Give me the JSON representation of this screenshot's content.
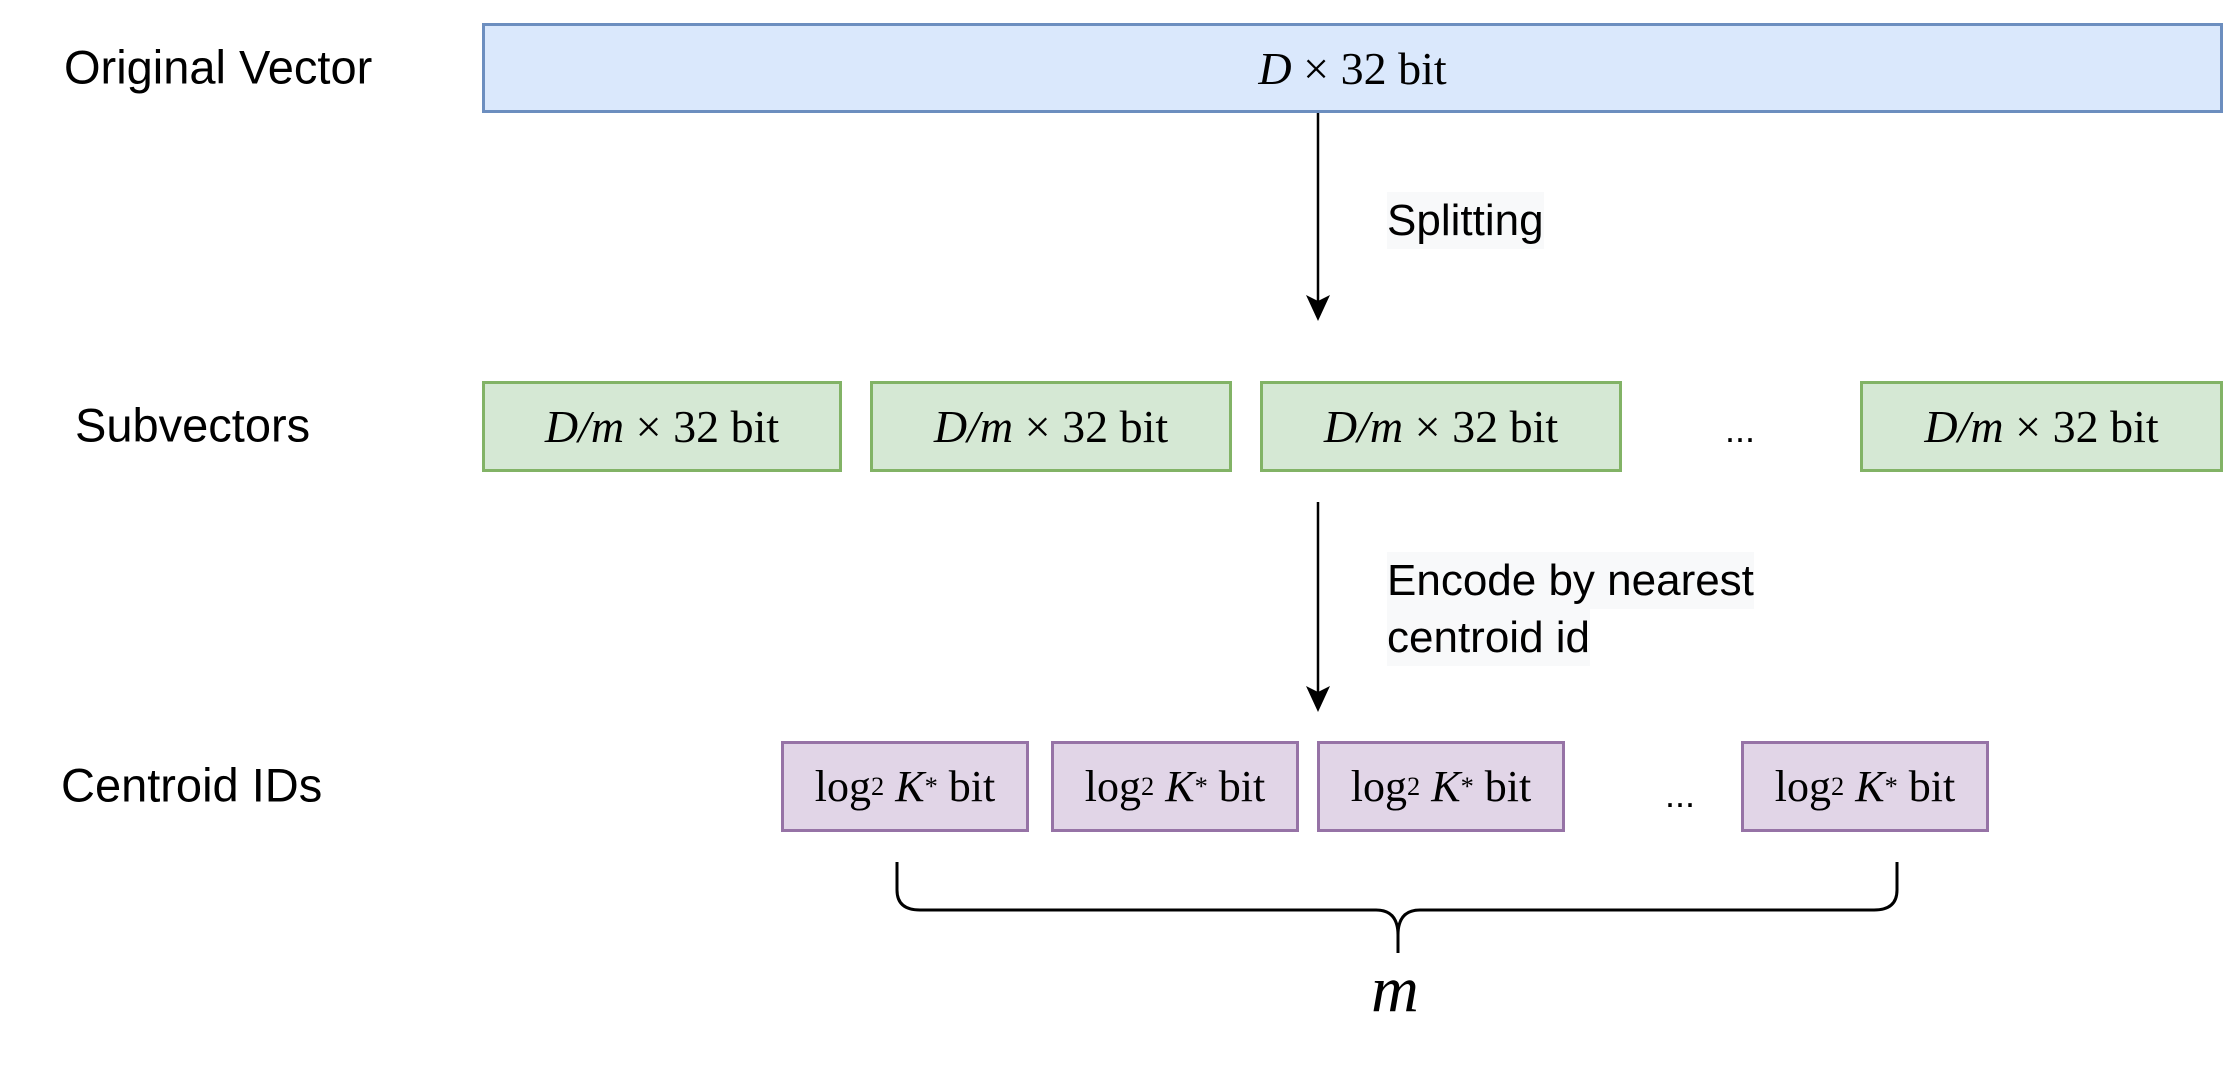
{
  "rows": {
    "original": {
      "label": "Original Vector",
      "box": {
        "var": "D",
        "op": "×",
        "rest": "32 bit"
      }
    },
    "subvectors": {
      "label": "Subvectors",
      "box": {
        "var": "D/m",
        "op": "×",
        "rest": "32 bit"
      },
      "ellipsis": "..."
    },
    "centroids": {
      "label": "Centroid IDs",
      "box": {
        "func": "log",
        "sub": "2",
        "var": "K",
        "sup": "*",
        "rest": "bit"
      },
      "ellipsis": "..."
    }
  },
  "edges": {
    "splitting": "Splitting",
    "encode_line1": "Encode by nearest",
    "encode_line2": "centroid id"
  },
  "brace_label": "m",
  "colors": {
    "original_fill": "#dae8fc",
    "original_stroke": "#6c8ebf",
    "sub_fill": "#d5e8d4",
    "sub_stroke": "#82b366",
    "centroid_fill": "#e1d5e7",
    "centroid_stroke": "#9673a6"
  }
}
